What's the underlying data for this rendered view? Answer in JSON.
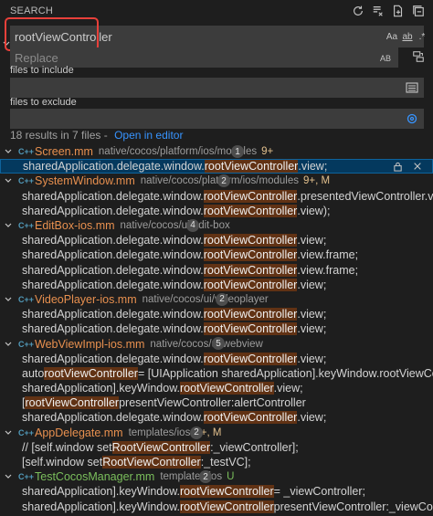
{
  "header": {
    "title": "SEARCH",
    "icons": [
      "refresh-icon",
      "clear-results-icon",
      "new-search-editor-icon",
      "collapse-all-icon"
    ]
  },
  "search": {
    "value": "rootViewController",
    "options": [
      "Aa",
      "ab",
      ".*"
    ]
  },
  "replace": {
    "placeholder": "Replace",
    "preserve_case": "AB"
  },
  "include": {
    "label": "files to include",
    "value": ""
  },
  "exclude": {
    "label": "files to exclude",
    "value": ""
  },
  "summary": {
    "text": "18 results in 7 files -",
    "open_link": "Open in editor"
  },
  "files": [
    {
      "name": "Screen.mm",
      "path": "native/cocos/platform/ios/modules",
      "badge": "9+",
      "count": "1",
      "matches": [
        {
          "before": "sharedApplication.delegate.window.",
          "hit": "rootViewController",
          "after": ".view;",
          "selected": true
        }
      ]
    },
    {
      "name": "SystemWindow.mm",
      "path": "native/cocos/platform/ios/modules",
      "badge": "9+, M",
      "count": "2",
      "matches": [
        {
          "before": "sharedApplication.delegate.window.",
          "hit": "rootViewController",
          "after": ".presentedViewController.view);"
        },
        {
          "before": "sharedApplication.delegate.window.",
          "hit": "rootViewController",
          "after": ".view);"
        }
      ]
    },
    {
      "name": "EditBox-ios.mm",
      "path": "native/cocos/ui/edit-box",
      "badge": "",
      "count": "4",
      "matches": [
        {
          "before": "sharedApplication.delegate.window.",
          "hit": "rootViewController",
          "after": ".view;"
        },
        {
          "before": "sharedApplication.delegate.window.",
          "hit": "rootViewController",
          "after": ".view.frame;"
        },
        {
          "before": "sharedApplication.delegate.window.",
          "hit": "rootViewController",
          "after": ".view.frame;"
        },
        {
          "before": "sharedApplication.delegate.window.",
          "hit": "rootViewController",
          "after": ".view;"
        }
      ]
    },
    {
      "name": "VideoPlayer-ios.mm",
      "path": "native/cocos/ui/videoplayer",
      "badge": "",
      "count": "2",
      "matches": [
        {
          "before": "sharedApplication.delegate.window.",
          "hit": "rootViewController",
          "after": ".view;"
        },
        {
          "before": "sharedApplication.delegate.window.",
          "hit": "rootViewController",
          "after": ".view;"
        }
      ]
    },
    {
      "name": "WebViewImpl-ios.mm",
      "path": "native/cocos/ui/webview",
      "badge": "",
      "count": "5",
      "matches": [
        {
          "before": "sharedApplication.delegate.window.",
          "hit": "rootViewController",
          "after": ".view;"
        },
        {
          "before": "auto ",
          "hit": "rootViewController",
          "after": " = [UIApplication sharedApplication].keyWindow.rootViewController;"
        },
        {
          "before": "sharedApplication].keyWindow.",
          "hit": "rootViewController",
          "after": ".view;"
        },
        {
          "before": "[",
          "hit": "rootViewController",
          "after": " presentViewController:alertController"
        },
        {
          "before": "sharedApplication.delegate.window.",
          "hit": "rootViewController",
          "after": ".view;"
        }
      ]
    },
    {
      "name": "AppDelegate.mm",
      "path": "templates/ios",
      "badge": "9+, M",
      "count": "2",
      "matches": [
        {
          "before": "//    [self.window set",
          "hit": "RootViewController",
          "after": ":_viewController];"
        },
        {
          "before": "[self.window set",
          "hit": "RootViewController",
          "after": ":_testVC];"
        }
      ]
    },
    {
      "name": "TestCocosManager.mm",
      "path": "templates/ios",
      "badge": "U",
      "count": "2",
      "green": true,
      "matches": [
        {
          "before": "sharedApplication].keyWindow.",
          "hit": "rootViewController",
          "after": " = _viewController;"
        },
        {
          "before": "sharedApplication].keyWindow.",
          "hit": "rootViewController",
          "after": " presentViewController:_viewController animated:YES..."
        }
      ]
    }
  ]
}
